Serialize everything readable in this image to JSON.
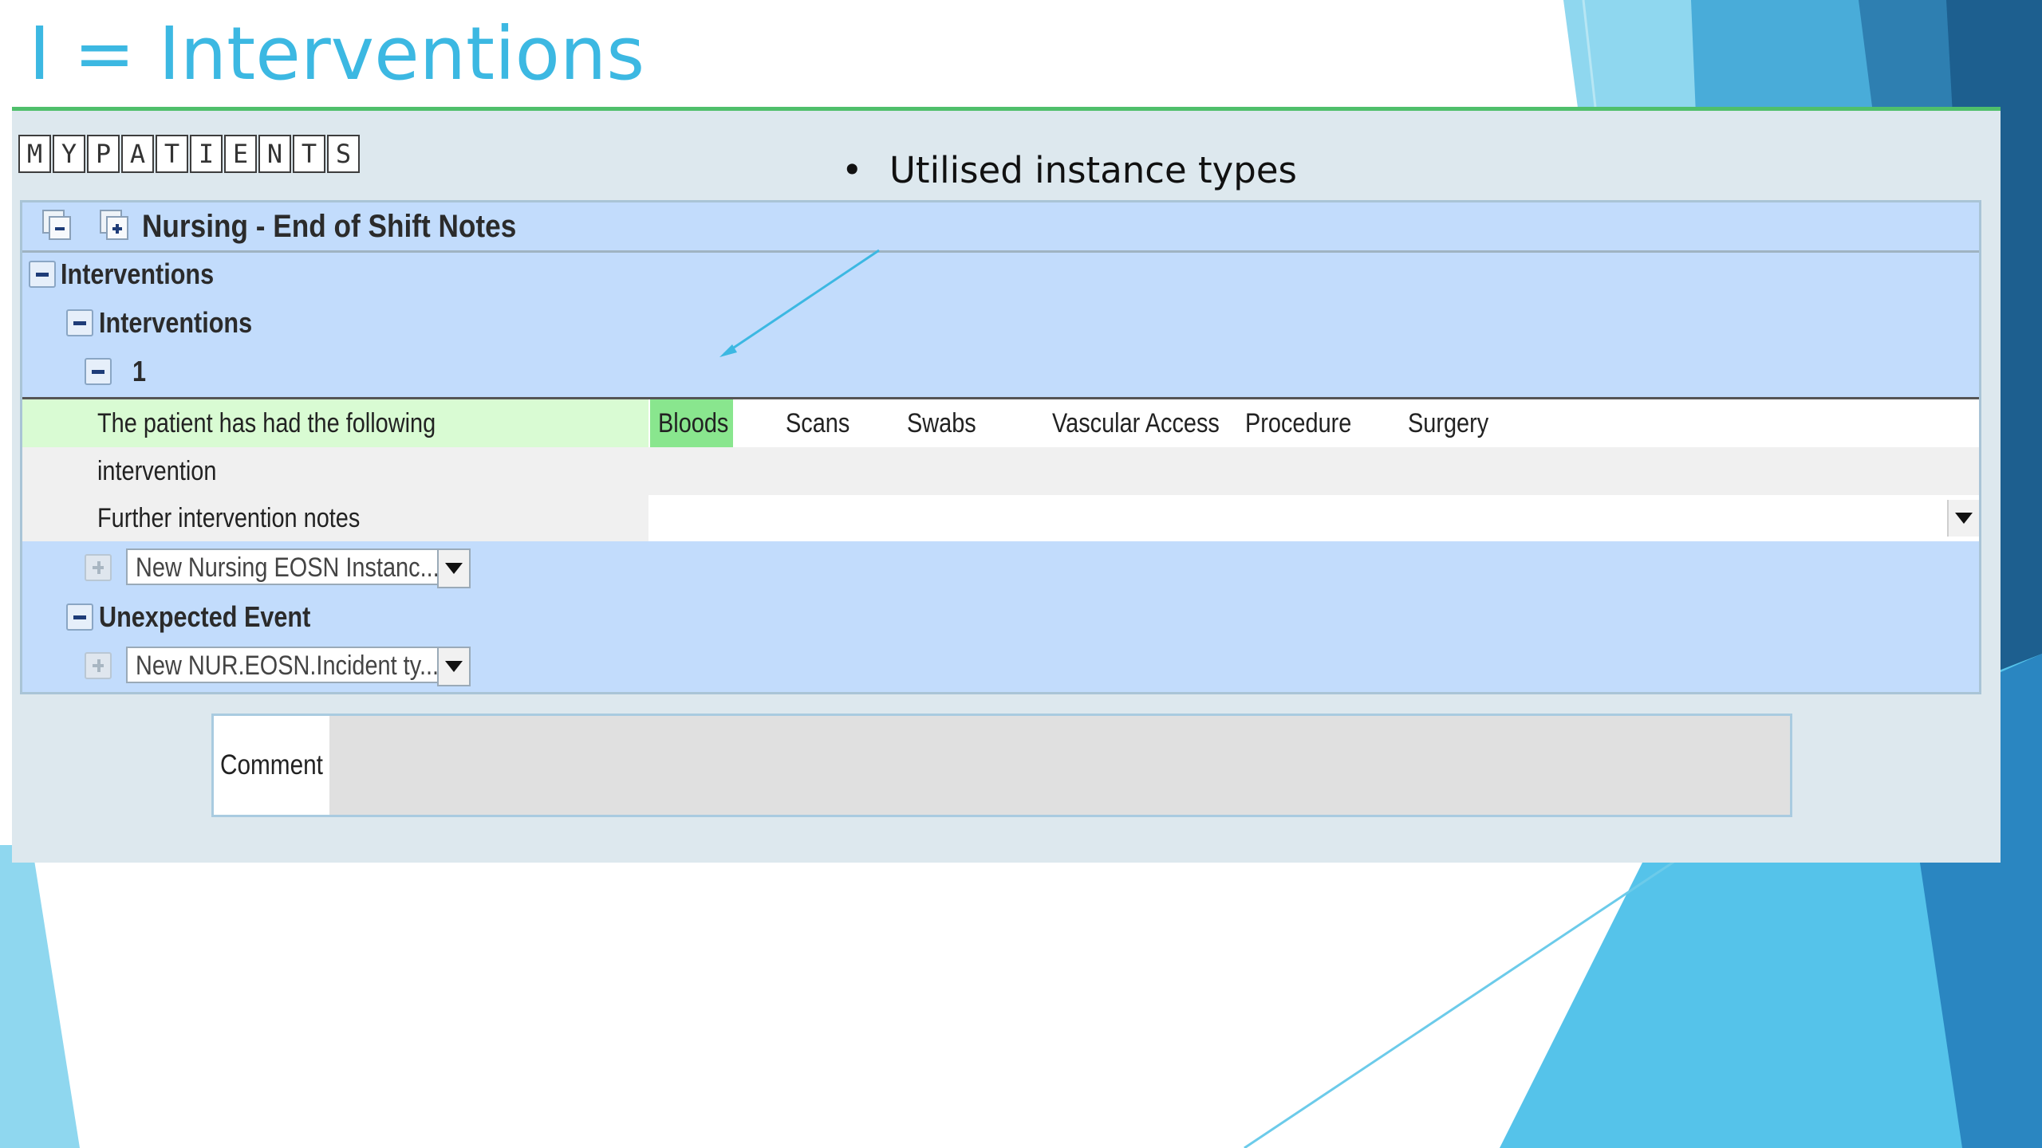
{
  "slide": {
    "title": "I = Interventions",
    "bullet": "Utilised instance types"
  },
  "logo": {
    "letters": [
      "M",
      "Y",
      "P",
      "A",
      "T",
      "I",
      "E",
      "N",
      "T",
      "S"
    ]
  },
  "form": {
    "title": "Nursing - End of Shift Notes",
    "section_label": "Interventions",
    "subsection_label": "Interventions",
    "instance_number": "1",
    "intervention_field": {
      "label_line1": "The patient has had the following",
      "label_line2": "intervention",
      "options": [
        "Bloods",
        "Scans",
        "Swabs",
        "Vascular Access",
        "Procedure",
        "Surgery"
      ],
      "selected": "Bloods"
    },
    "notes_field": {
      "label": "Further intervention notes",
      "value": ""
    },
    "new_instance_select": "New Nursing EOSN Instanc...",
    "unexpected_event_label": "Unexpected Event",
    "new_incident_select": "New NUR.EOSN.Incident ty..."
  },
  "comment": {
    "label": "Comment",
    "value": ""
  },
  "colors": {
    "title_blue": "#3cb8e2",
    "panel_blue": "#c2dcfc",
    "selected_green": "#89e68e",
    "label_highlight_green": "#d9fbd3"
  }
}
